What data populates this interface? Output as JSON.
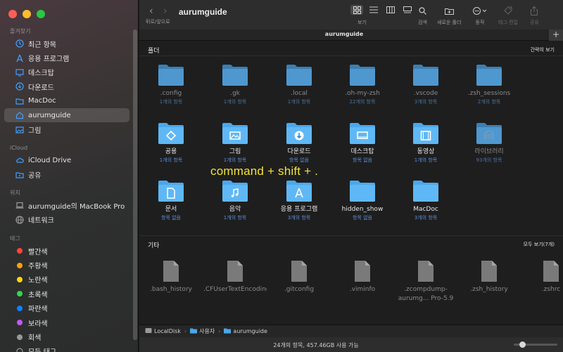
{
  "window": {
    "title": "aurumguide"
  },
  "toolbar": {
    "back_label": "뒤로/앞으로",
    "view_label": "보기",
    "search_label": "검색",
    "new_folder_label": "새로운 폴더",
    "action_label": "동작",
    "tag_edit_label": "태그 편집",
    "share_label": "공유"
  },
  "tabbar": {
    "title": "aurumguide",
    "plus": "+"
  },
  "sidebar": {
    "favorites_head": "즐겨찾기",
    "favorites": [
      {
        "label": "최근 항목",
        "icon": "clock-icon"
      },
      {
        "label": "응용 프로그램",
        "icon": "applications-icon"
      },
      {
        "label": "데스크탑",
        "icon": "desktop-icon"
      },
      {
        "label": "다운로드",
        "icon": "download-icon"
      },
      {
        "label": "MacDoc",
        "icon": "folder-icon"
      },
      {
        "label": "aurumguide",
        "icon": "home-icon"
      },
      {
        "label": "그림",
        "icon": "pictures-icon"
      }
    ],
    "icloud_head": "iCloud",
    "icloud": [
      {
        "label": "iCloud Drive",
        "icon": "cloud-icon"
      },
      {
        "label": "공유",
        "icon": "shared-folder-icon"
      }
    ],
    "locations_head": "위치",
    "locations": [
      {
        "label": "aurumguide의 MacBook Pro",
        "icon": "laptop-icon"
      },
      {
        "label": "네트워크",
        "icon": "network-icon"
      }
    ],
    "tags_head": "태그",
    "tags": [
      {
        "label": "빨간색",
        "color": "#ff453a"
      },
      {
        "label": "주황색",
        "color": "#ff9f0a"
      },
      {
        "label": "노란색",
        "color": "#ffd60a"
      },
      {
        "label": "초록색",
        "color": "#32d74b"
      },
      {
        "label": "파란색",
        "color": "#0a84ff"
      },
      {
        "label": "보라색",
        "color": "#bf5af2"
      },
      {
        "label": "회색",
        "color": "#98989d"
      },
      {
        "label": "모든 태그",
        "color": ""
      }
    ]
  },
  "content": {
    "folders_head": "폴더",
    "folders_btn": "간략히 보기",
    "folders": [
      {
        "name": ".config",
        "count": "1개의 항목",
        "hidden": true,
        "badge": ""
      },
      {
        "name": ".gk",
        "count": "1개의 항목",
        "hidden": true,
        "badge": ""
      },
      {
        "name": ".local",
        "count": "1개의 항목",
        "hidden": true,
        "badge": ""
      },
      {
        "name": ".oh-my-zsh",
        "count": "22개의 항목",
        "hidden": true,
        "badge": ""
      },
      {
        "name": ".vscode",
        "count": "3개의 항목",
        "hidden": true,
        "badge": ""
      },
      {
        "name": ".zsh_sessions",
        "count": "2개의 항목",
        "hidden": true,
        "badge": ""
      },
      {
        "name": "공용",
        "count": "1개의 항목",
        "hidden": false,
        "badge": "public"
      },
      {
        "name": "그림",
        "count": "1개의 항목",
        "hidden": false,
        "badge": "pictures"
      },
      {
        "name": "다운로드",
        "count": "항목 없음",
        "hidden": false,
        "badge": "download"
      },
      {
        "name": "데스크탑",
        "count": "항목 없음",
        "hidden": false,
        "badge": "desktop"
      },
      {
        "name": "동영상",
        "count": "1개의 항목",
        "hidden": false,
        "badge": "movies"
      },
      {
        "name": "라이브러리",
        "count": "93개의 항목",
        "hidden": true,
        "badge": "library"
      },
      {
        "name": "문서",
        "count": "항목 없음",
        "hidden": false,
        "badge": "documents"
      },
      {
        "name": "음악",
        "count": "1개의 항목",
        "hidden": false,
        "badge": "music"
      },
      {
        "name": "응용 프로그램",
        "count": "3개의 항목",
        "hidden": false,
        "badge": "applications"
      },
      {
        "name": "hidden_show",
        "count": "항목 없음",
        "hidden": false,
        "badge": ""
      },
      {
        "name": "MacDoc",
        "count": "3개의 항목",
        "hidden": false,
        "badge": ""
      }
    ],
    "others_head": "기타",
    "others_btn": "모두 보기(7개)",
    "others": [
      {
        "name": ".bash_history"
      },
      {
        "name": ".CFUserTextEncoding"
      },
      {
        "name": ".gitconfig"
      },
      {
        "name": ".viminfo"
      },
      {
        "name": ".zcompdump-aurumg... Pro-5.9"
      },
      {
        "name": ".zsh_history"
      },
      {
        "name": ".zshrc"
      }
    ],
    "overlay_text": "command + shift + ."
  },
  "pathbar": {
    "items": [
      "LocalDisk",
      "사용자",
      "aurumguide"
    ]
  },
  "statusbar": {
    "text": "24개의 항목, 457.46GB 사용 가능",
    "icon_size_fraction": 0.15
  }
}
